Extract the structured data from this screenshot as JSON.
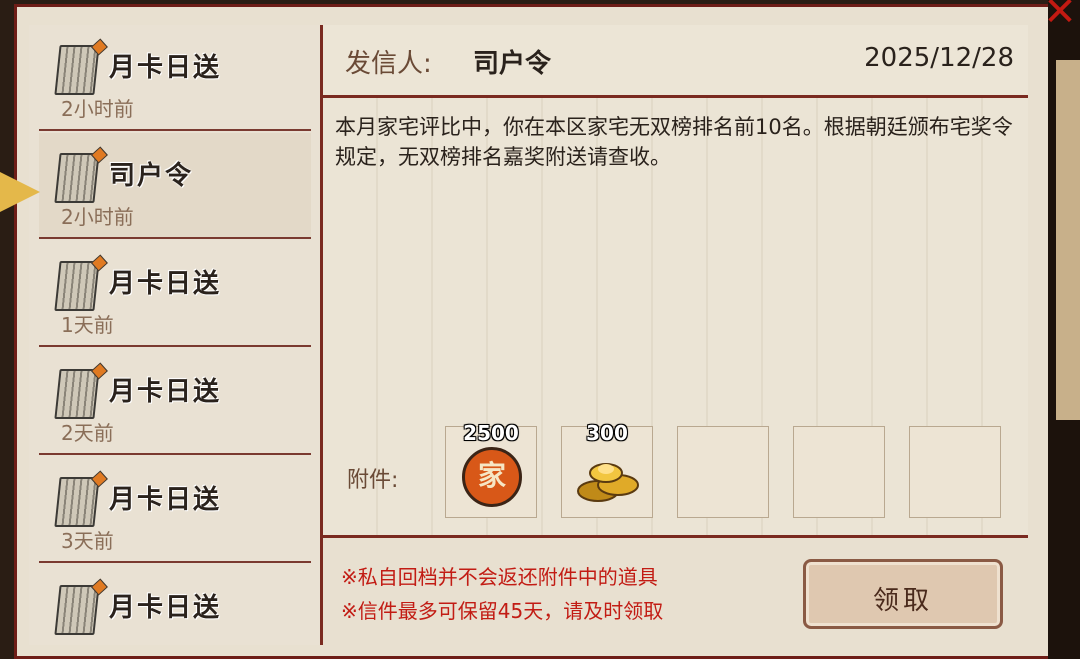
{
  "mail_list": [
    {
      "title": "月卡日送",
      "time": "2小时前"
    },
    {
      "title": "司户令",
      "time": "2小时前",
      "selected": true
    },
    {
      "title": "月卡日送",
      "time": "1天前"
    },
    {
      "title": "月卡日送",
      "time": "2天前"
    },
    {
      "title": "月卡日送",
      "time": "3天前"
    },
    {
      "title": "月卡日送",
      "time": ""
    }
  ],
  "header": {
    "sender_label": "发信人:",
    "sender_name": "司户令",
    "date": "2025/12/28"
  },
  "message": {
    "text": "本月家宅评比中，你在本区家宅无双榜排名前10名。根据朝廷颁布宅奖令规定，无双榜排名嘉奖附送请查收。"
  },
  "attachments": {
    "label": "附件:",
    "items": [
      {
        "icon": "jia-coin-icon",
        "count": "2500",
        "glyph": "家"
      },
      {
        "icon": "gold-ingot-icon",
        "count": "300"
      },
      {
        "icon": "empty-slot"
      },
      {
        "icon": "empty-slot"
      },
      {
        "icon": "empty-slot"
      }
    ]
  },
  "footer": {
    "notice_1": "※私自回档并不会返还附件中的道具",
    "notice_2": "※信件最多可保留45天，请及时领取",
    "claim_label": "领取"
  },
  "colors": {
    "border": "#7a2a20",
    "notice": "#c21c14",
    "paper": "#e8e0d0"
  }
}
